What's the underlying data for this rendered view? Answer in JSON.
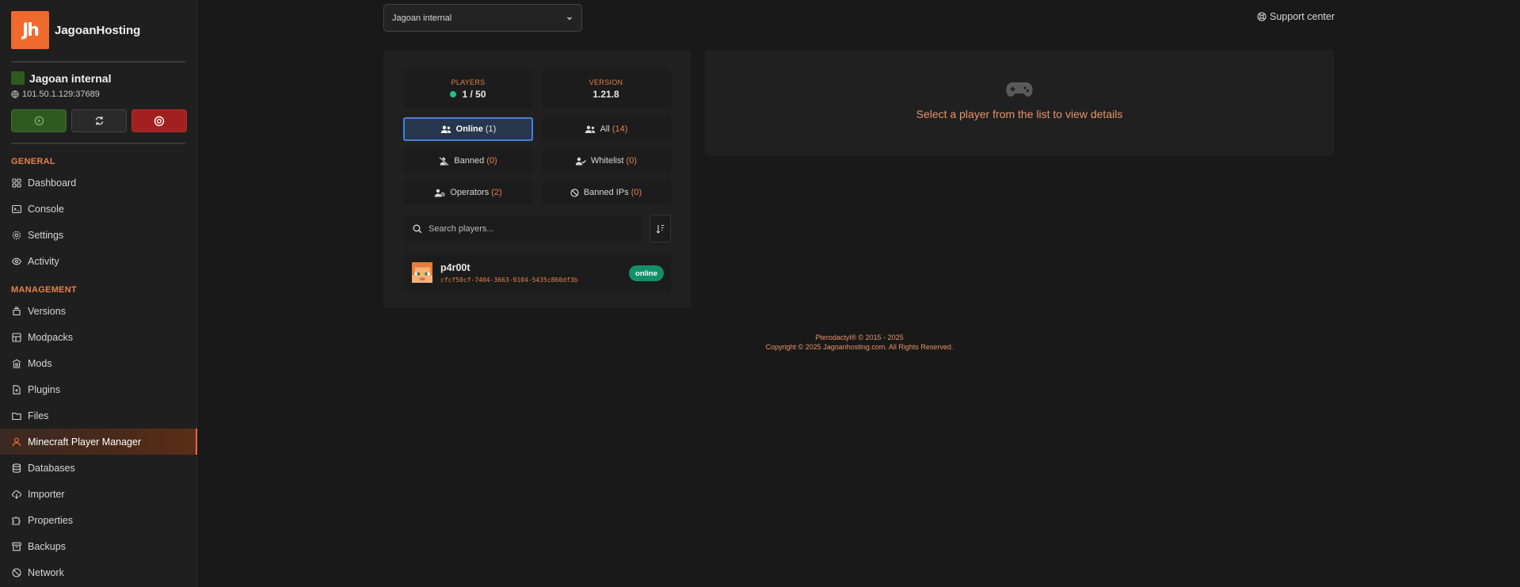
{
  "brand": {
    "logo_text": "Jh",
    "name": "JagoanHosting"
  },
  "server": {
    "name": "Jagoan internal",
    "ip": "101.50.1.129:37689"
  },
  "sidebar": {
    "general_label": "GENERAL",
    "general_items": [
      {
        "label": "Dashboard",
        "icon": "grid-icon"
      },
      {
        "label": "Console",
        "icon": "terminal-icon"
      },
      {
        "label": "Settings",
        "icon": "gear-icon"
      },
      {
        "label": "Activity",
        "icon": "eye-icon"
      }
    ],
    "management_label": "MANAGEMENT",
    "management_items": [
      {
        "label": "Versions",
        "icon": "layers-icon"
      },
      {
        "label": "Modpacks",
        "icon": "modpack-icon"
      },
      {
        "label": "Mods",
        "icon": "bank-icon"
      },
      {
        "label": "Plugins",
        "icon": "plugin-file-icon"
      },
      {
        "label": "Files",
        "icon": "folder-icon"
      },
      {
        "label": "Minecraft Player Manager",
        "icon": "user-icon",
        "active": true
      },
      {
        "label": "Databases",
        "icon": "database-icon"
      },
      {
        "label": "Importer",
        "icon": "cloud-download-icon"
      },
      {
        "label": "Properties",
        "icon": "puzzle-icon"
      },
      {
        "label": "Backups",
        "icon": "archive-icon"
      },
      {
        "label": "Network",
        "icon": "network-icon"
      }
    ]
  },
  "top": {
    "server_select": "Jagoan internal",
    "support": "Support center"
  },
  "stats": {
    "players_label": "PLAYERS",
    "players_value": "1 / 50",
    "version_label": "VERSION",
    "version_value": "1.21.8"
  },
  "filters": {
    "online": {
      "label": "Online",
      "count": "(1)"
    },
    "all": {
      "label": "All",
      "count": "(14)"
    },
    "banned": {
      "label": "Banned",
      "count": "(0)"
    },
    "whitelist": {
      "label": "Whitelist",
      "count": "(0)"
    },
    "operators": {
      "label": "Operators",
      "count": "(2)"
    },
    "banned_ips": {
      "label": "Banned IPs",
      "count": "(0)"
    }
  },
  "search": {
    "placeholder": "Search players..."
  },
  "players": [
    {
      "name": "p4r00t",
      "uuid": "cfcf50cf-7404-3663-9104-5435c860df3b",
      "status": "online"
    }
  ],
  "details": {
    "hint": "Select a player from the list to view details"
  },
  "footer": {
    "line1": "Pterodactyl® © 2015 - 2025",
    "line2": "Copyright © 2025 Jagoanhosting.com. All Rights Reserved."
  },
  "colors": {
    "accent": "#f06a2e",
    "online": "#12906a",
    "active_filter": "#4a7fd8",
    "stop": "#a32020",
    "start": "#2f5a1f"
  }
}
